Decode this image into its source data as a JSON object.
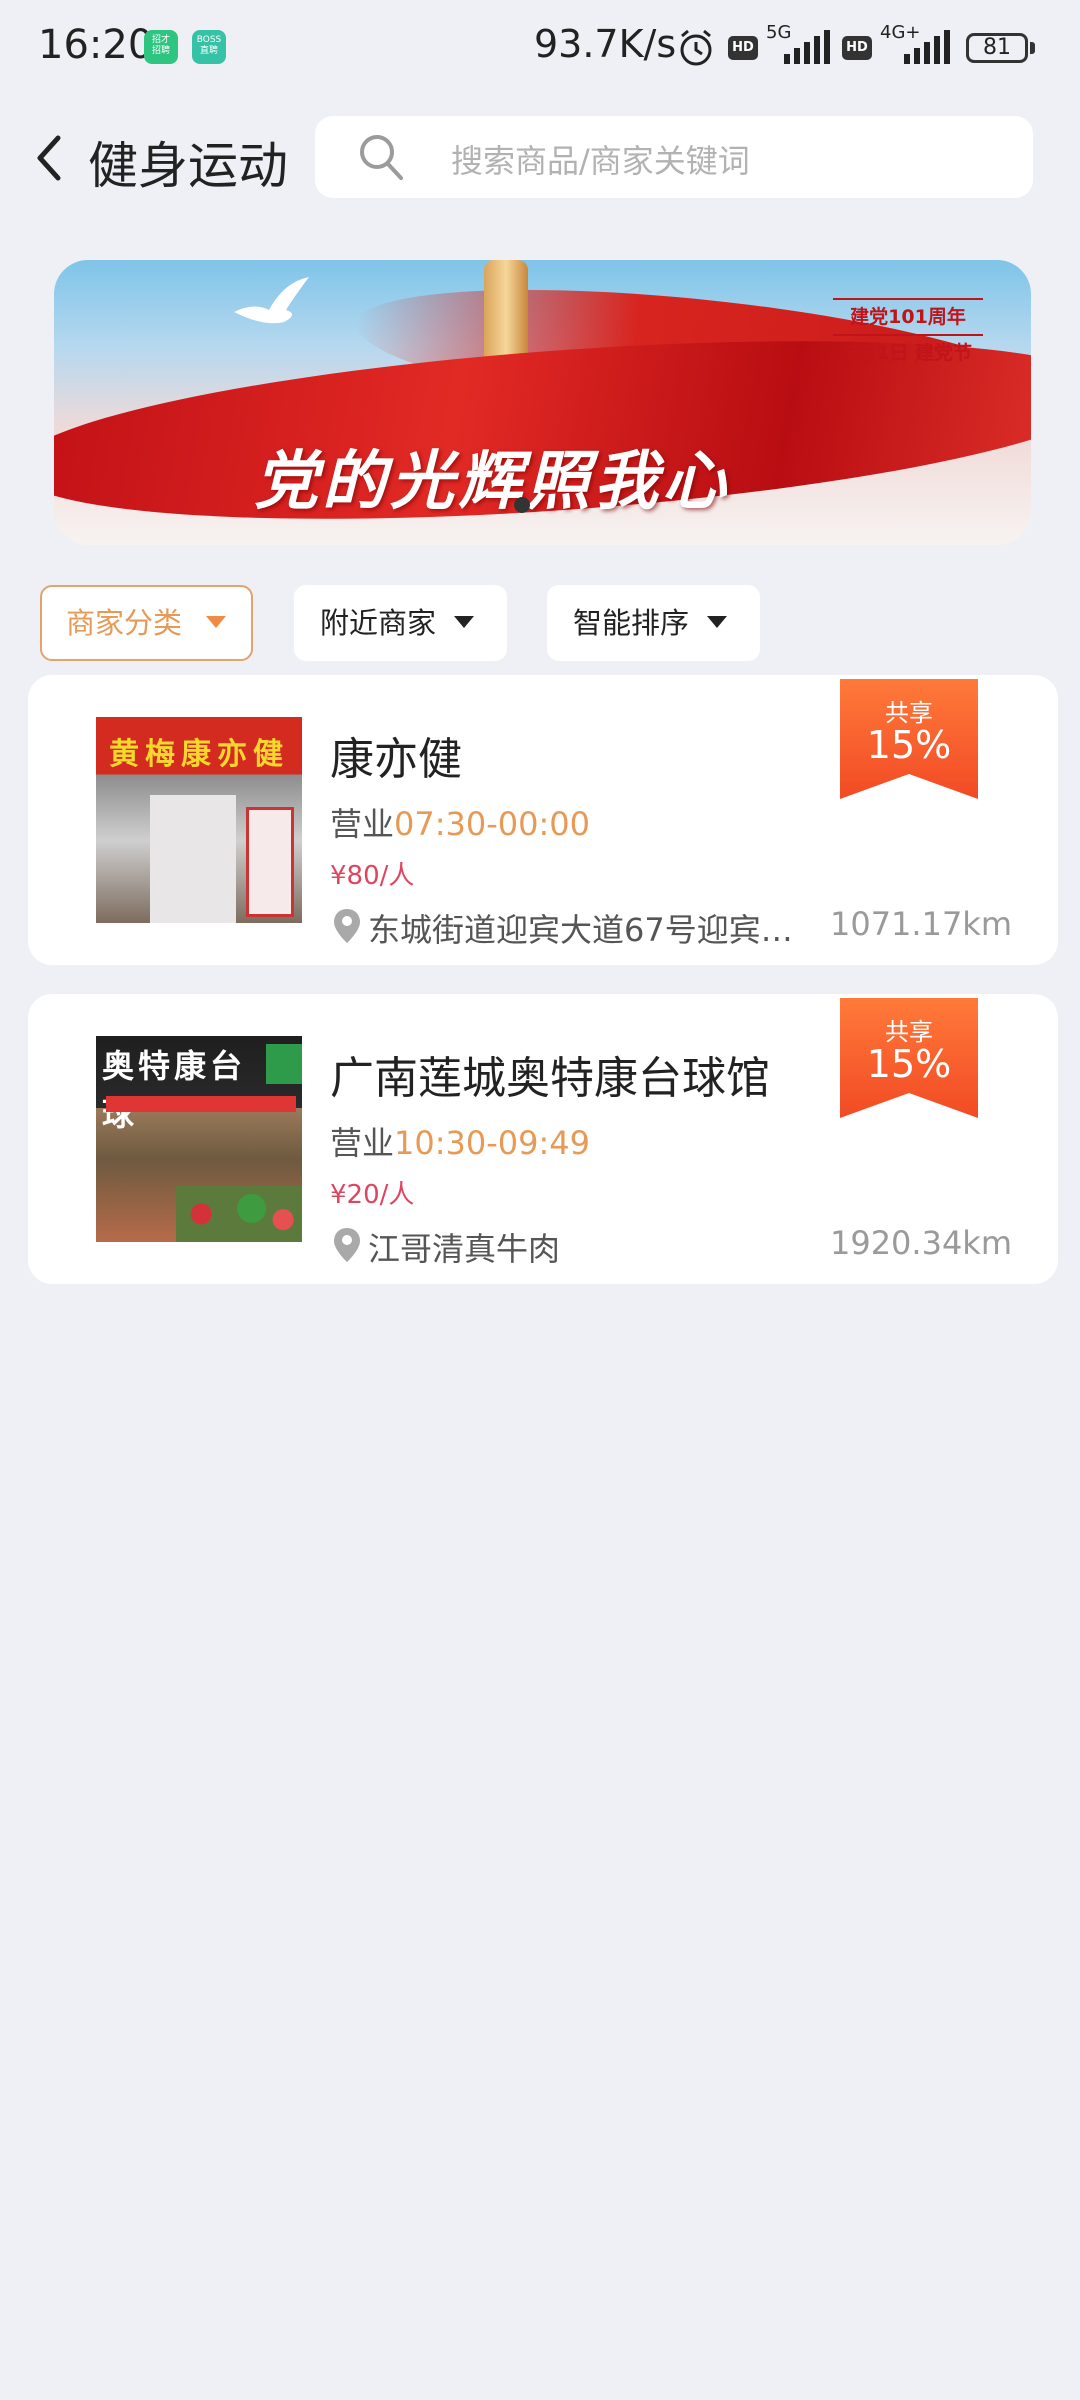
{
  "status_bar": {
    "time": "16:20",
    "app_badge_1": "招才\n招聘",
    "app_badge_2": "BOSS\n直聘",
    "net_speed": "93.7K/s",
    "hd": "HD",
    "net_1": "5G",
    "net_2": "4G+",
    "battery": "81"
  },
  "header": {
    "title": "健身运动",
    "search_placeholder": "搜索商品/商家关键词"
  },
  "banner": {
    "slogan": "党的光辉照我心",
    "tag_line_1": "建党101周年",
    "tag_line_2": "7月1日 建党节"
  },
  "filters": [
    {
      "label": "商家分类",
      "active": true
    },
    {
      "label": "附近商家",
      "active": false
    },
    {
      "label": "智能排序",
      "active": false
    }
  ],
  "merchants": [
    {
      "name": "康亦健",
      "hours_prefix": "营业",
      "hours": "07:30-00:00",
      "price": "¥80/人",
      "address": "东城街道迎宾大道67号迎宾…",
      "distance": "1071.17km",
      "share_label": "共享",
      "share_value": "15%",
      "photo_sign": "黄梅康亦健"
    },
    {
      "name": "广南莲城奥特康台球馆",
      "hours_prefix": "营业",
      "hours": "10:30-09:49",
      "price": "¥20/人",
      "address": "江哥清真牛肉",
      "distance": "1920.34km",
      "share_label": "共享",
      "share_value": "15%",
      "photo_sign": "奥特康台球"
    }
  ],
  "colors": {
    "accent": "#e79a56",
    "price": "#e0455f",
    "share_tag": "#f25a2b",
    "background": "#eff0f5"
  }
}
